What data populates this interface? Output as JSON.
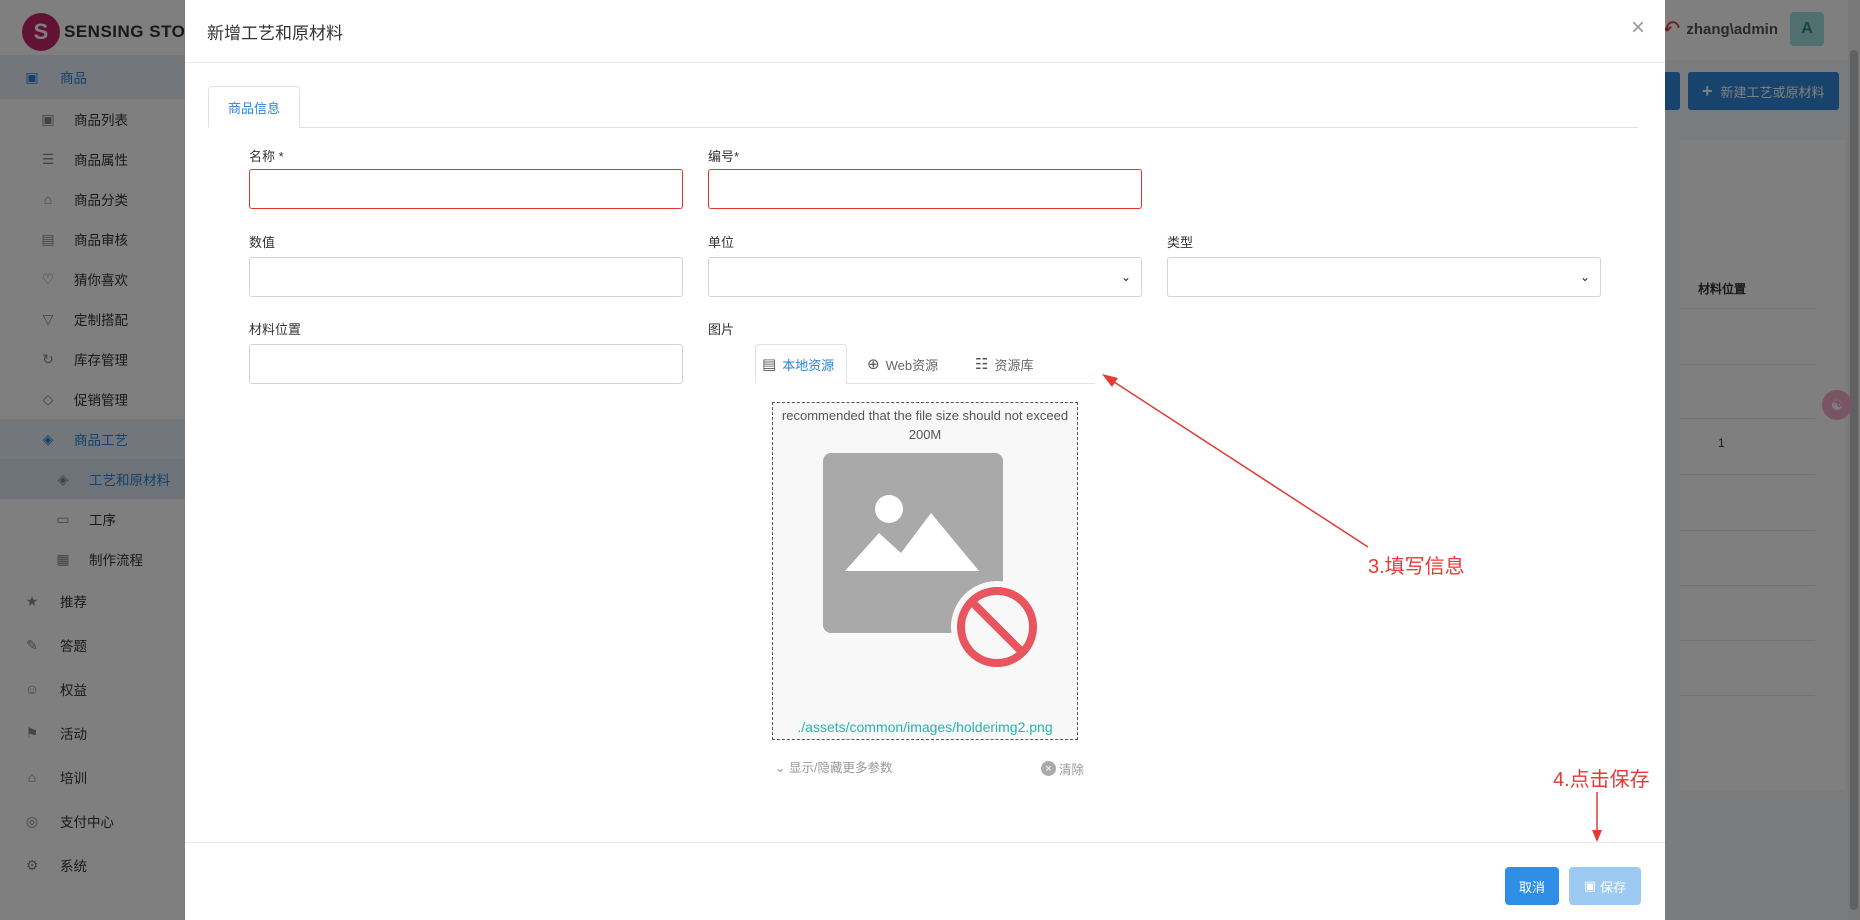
{
  "app": {
    "brand": "SENSING STOR",
    "user": "zhang\\admin",
    "avatar_letter": "A"
  },
  "sidebar": {
    "items": [
      {
        "label": "商品",
        "level": 1,
        "state": "active"
      },
      {
        "label": "商品列表",
        "level": 2
      },
      {
        "label": "商品属性",
        "level": 2
      },
      {
        "label": "商品分类",
        "level": 2
      },
      {
        "label": "商品审核",
        "level": 2
      },
      {
        "label": "猜你喜欢",
        "level": 2
      },
      {
        "label": "定制搭配",
        "level": 2
      },
      {
        "label": "库存管理",
        "level": 2
      },
      {
        "label": "促销管理",
        "level": 2
      },
      {
        "label": "商品工艺",
        "level": 2,
        "state": "active"
      },
      {
        "label": "工艺和原材料",
        "level": 3,
        "state": "selected"
      },
      {
        "label": "工序",
        "level": 3
      },
      {
        "label": "制作流程",
        "level": 3
      },
      {
        "label": "推荐",
        "level": 1
      },
      {
        "label": "答题",
        "level": 1
      },
      {
        "label": "权益",
        "level": 1
      },
      {
        "label": "活动",
        "level": 1
      },
      {
        "label": "培训",
        "level": 1
      },
      {
        "label": "支付中心",
        "level": 1
      },
      {
        "label": "系统",
        "level": 1
      }
    ]
  },
  "background": {
    "new_button": "新建工艺或原材料",
    "column_header": "材料位置",
    "cell_value": "1"
  },
  "modal": {
    "title": "新增工艺和原材料",
    "close": "×",
    "tab": "商品信息",
    "fields": {
      "name_label": "名称 *",
      "name_value": "",
      "code_label": "编号*",
      "code_value": "",
      "value_label": "数值",
      "value_value": "",
      "unit_label": "单位",
      "unit_value": "",
      "type_label": "类型",
      "type_value": "",
      "position_label": "材料位置",
      "position_value": "",
      "image_label": "图片"
    },
    "image_tabs": [
      {
        "label": "本地资源",
        "active": true
      },
      {
        "label": "Web资源",
        "active": false
      },
      {
        "label": "资源库",
        "active": false
      }
    ],
    "upload": {
      "note": "recommended that the file size should not exceed 200M",
      "path": "./assets/common/images/holderimg2.png",
      "more_params": "显示/隐藏更多参数",
      "clear": "清除"
    },
    "footer": {
      "cancel": "取消",
      "save": "保存"
    }
  },
  "annotations": {
    "step3": "3.填写信息",
    "step4": "4.点击保存"
  },
  "colors": {
    "primary": "#2f8ee5",
    "save_disabled": "#9ccaf2",
    "invalid_border": "#e3342f",
    "annotation": "#e53935",
    "path_text": "#26b3b0"
  }
}
